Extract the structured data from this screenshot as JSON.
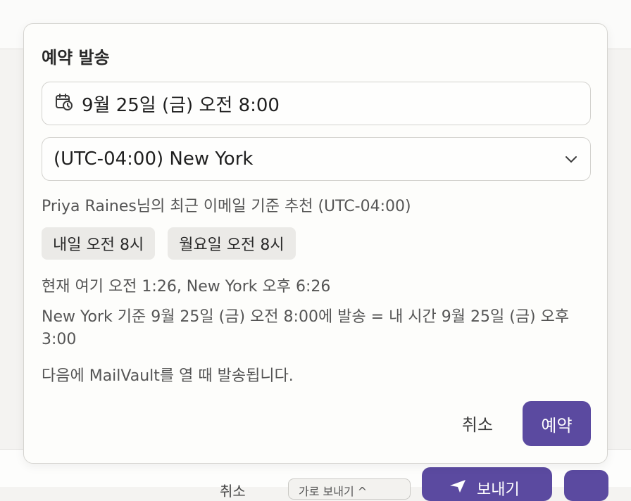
{
  "background": {
    "cancel_label": "취소",
    "chip_label": "가로 보내기 ^",
    "send_label": "보내기"
  },
  "dialog": {
    "title": "예약 발송",
    "date_value": "9월 25일 (금) 오전 8:00",
    "timezone_value": "(UTC-04:00) New York",
    "recommendation_text": "Priya Raines님의 최근 이메일 기준 추천 (UTC-04:00)",
    "suggestions": [
      "내일 오전 8시",
      "월요일 오전 8시"
    ],
    "current_time_text": "현재 여기 오전 1:26, New York 오후 6:26",
    "conversion_text": "New York 기준 9월 25일 (금) 오전 8:00에 발송 = 내 시간 9월 25일 (금) 오후 3:00",
    "offline_note": "다음에 MailVault를 열 때 발송됩니다.",
    "cancel_label": "취소",
    "confirm_label": "예약"
  },
  "colors": {
    "accent": "#5b4aa0",
    "chip_bg": "#ebeae7",
    "border": "#d3d2ce"
  },
  "icons": [
    "calendar-clock-icon",
    "chevron-down-icon",
    "send-icon"
  ]
}
